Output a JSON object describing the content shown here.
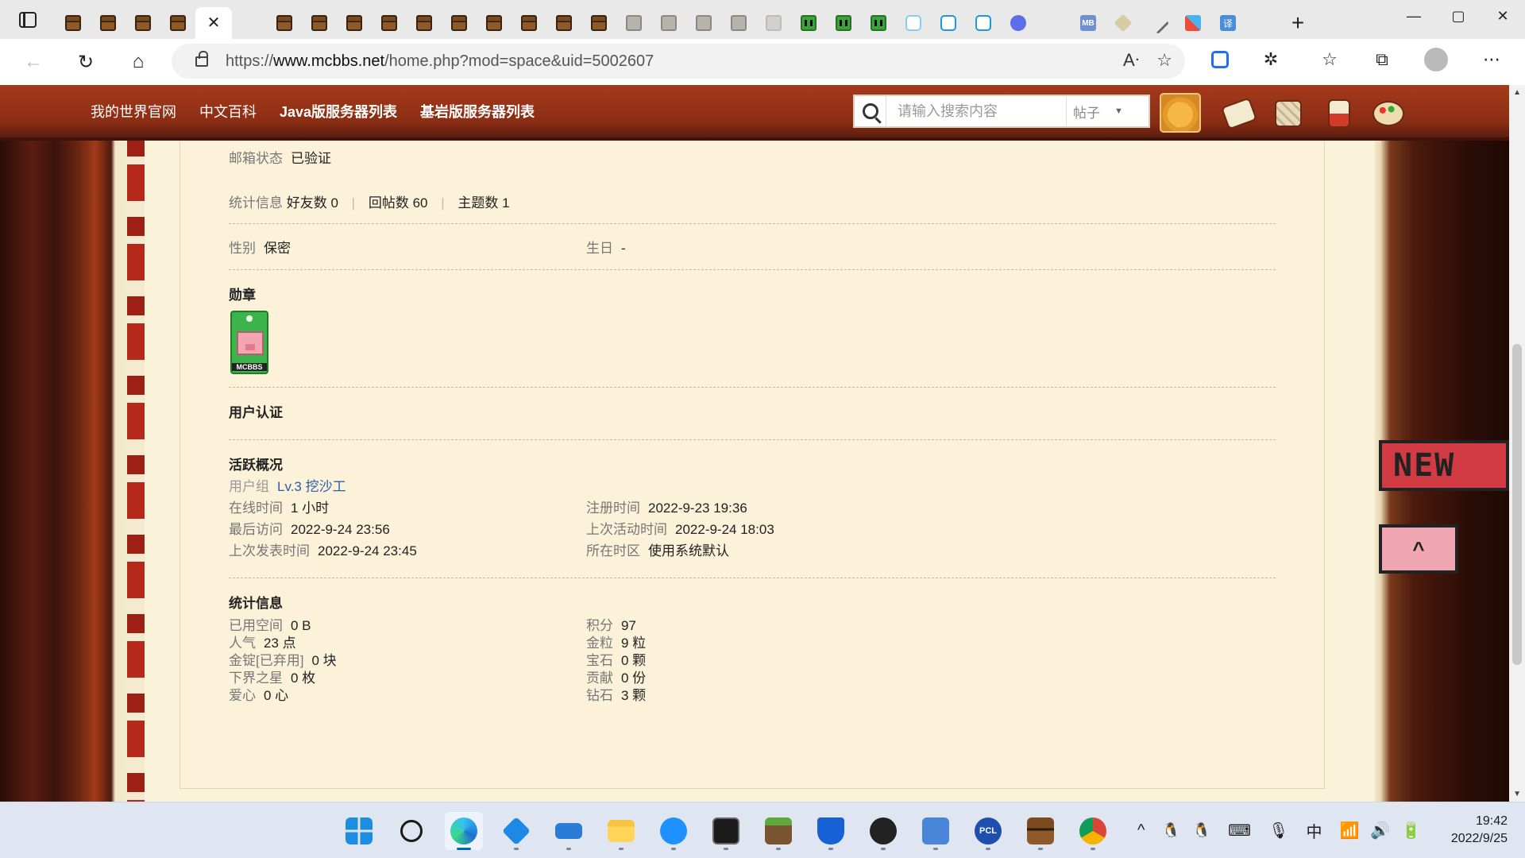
{
  "browser": {
    "active_tab_close": "✕",
    "new_tab": "+",
    "window_controls": {
      "minimize": "—",
      "maximize": "▢",
      "close": "✕"
    },
    "url_prefix": "https://",
    "url_domain": "www.mcbbs.net",
    "url_path": "/home.php?mod=space&uid=5002607",
    "tab_favicons": [
      "chest",
      "chest",
      "chest",
      "chest",
      "active",
      "page",
      "chest",
      "chest",
      "chest",
      "chest",
      "chest",
      "chest",
      "chest",
      "chest",
      "chest",
      "chest",
      "chest-gray",
      "chest-gray",
      "chest-gray",
      "chest-gray",
      "light",
      "creeper",
      "creeper",
      "creeper",
      "bilibili-light",
      "bilibili",
      "bilibili",
      "baidu-paw",
      "page",
      "mb",
      "cube",
      "tool",
      "xlogo",
      "translate",
      "page"
    ],
    "toolbar_icons": [
      "back-icon",
      "refresh-icon",
      "home-icon",
      "read-aloud-icon",
      "add-favorite-icon",
      "extension-blue-icon",
      "extensions-icon",
      "favorites-icon",
      "collections-icon",
      "profile-icon",
      "more-icon"
    ]
  },
  "site": {
    "nav": [
      "我的世界官网",
      "中文百科",
      "Java版服务器列表",
      "基岩版服务器列表"
    ],
    "search_placeholder": "请输入搜索内容",
    "search_type": "帖子"
  },
  "profile": {
    "email_status_label": "邮箱状态",
    "email_status_value": "已验证",
    "stats_label": "统计信息",
    "friends_label": "好友数",
    "friends_value": "0",
    "replies_label": "回帖数",
    "replies_value": "60",
    "threads_label": "主题数",
    "threads_value": "1",
    "gender_label": "性别",
    "gender_value": "保密",
    "birthday_label": "生日",
    "birthday_value": "-",
    "medals_title": "勋章",
    "medal_text": "MCBBS",
    "certification_title": "用户认证",
    "activity_title": "活跃概况",
    "usergroup_label": "用户组",
    "usergroup_value": "Lv.3 挖沙工",
    "online_label": "在线时间",
    "online_value": "1 小时",
    "register_label": "注册时间",
    "register_value": "2022-9-23 19:36",
    "last_visit_label": "最后访问",
    "last_visit_value": "2022-9-24 23:56",
    "last_active_label": "上次活动时间",
    "last_active_value": "2022-9-24 18:03",
    "last_post_label": "上次发表时间",
    "last_post_value": "2022-9-24 23:45",
    "timezone_label": "所在时区",
    "timezone_value": "使用系统默认",
    "stats_title": "统计信息",
    "left_stats": [
      {
        "label": "已用空间",
        "value": "0 B"
      },
      {
        "label": "人气",
        "value": "23 点"
      },
      {
        "label": "金锭[已弃用]",
        "value": "0 块"
      },
      {
        "label": "下界之星",
        "value": "0 枚"
      },
      {
        "label": "爱心",
        "value": "0 心"
      }
    ],
    "right_stats": [
      {
        "label": "积分",
        "value": "97"
      },
      {
        "label": "金粒",
        "value": "9 粒"
      },
      {
        "label": "宝石",
        "value": "0 颗"
      },
      {
        "label": "贡献",
        "value": "0 份"
      },
      {
        "label": "钻石",
        "value": "3 颗"
      }
    ]
  },
  "side_badges": {
    "new": "NEW",
    "top": "^"
  },
  "taskbar": {
    "apps": [
      "windows-start",
      "search",
      "edge",
      "3d-cube",
      "whiteboard",
      "file-explorer",
      "ie",
      "terminal",
      "minecraft-grass",
      "shield",
      "pickaxe",
      "remote-desktop",
      "pcl",
      "chest",
      "chrome"
    ],
    "tray": {
      "chevron": "^",
      "ime": "中",
      "time": "19:42",
      "date": "2022/9/25"
    }
  }
}
